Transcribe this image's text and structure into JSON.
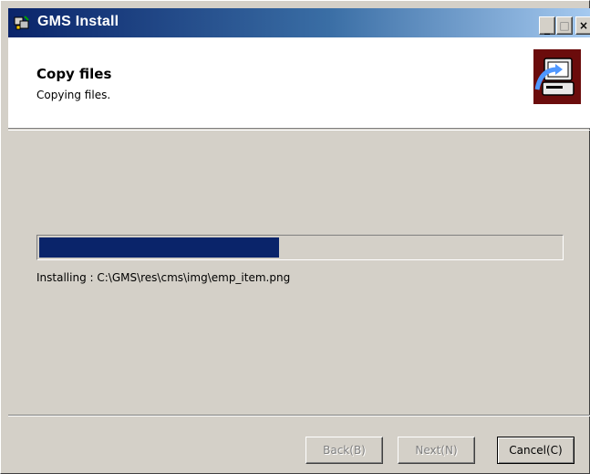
{
  "window": {
    "title": "GMS Install",
    "minimize_glyph": "_",
    "maximize_glyph": "□",
    "close_glyph": "×",
    "title_gradient_start": "#0a246a",
    "title_gradient_end": "#a6caf0"
  },
  "header": {
    "title": "Copy files",
    "subtitle": "Copying files.",
    "icon": "computer-install-icon",
    "icon_bg": "#6b0c0c"
  },
  "main": {
    "progress_fraction": 0.46,
    "progress_color": "#0a246a",
    "status_text": "Installing : C:\\GMS\\res\\cms\\img\\emp_item.png"
  },
  "footer": {
    "back_label": "Back(B)",
    "next_label": "Next(N)",
    "cancel_label": "Cancel(C)"
  }
}
